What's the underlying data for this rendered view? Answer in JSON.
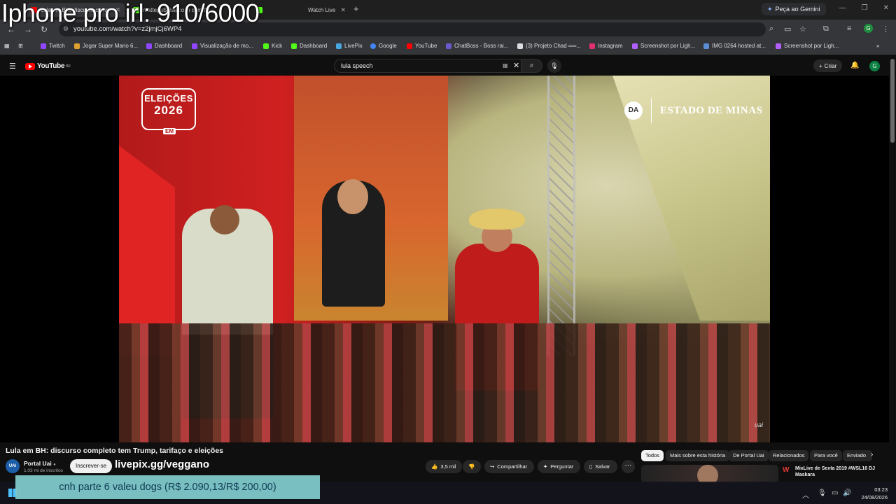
{
  "browser": {
    "tabs": [
      {
        "title": "Lula em BH: discurso comp",
        "active": true,
        "color": "#ff0000"
      },
      {
        "title": "mattepaSdisiaco in com.fhi",
        "active": false,
        "color": "#53fc18"
      },
      {
        "title": "Watch Live",
        "active": false,
        "color": "#53fc18"
      }
    ],
    "gemini_label": "Peça ao Gemini",
    "url": "youtube.com/watch?v=z2jmjCj6WP4",
    "profile_letter": "G"
  },
  "bookmarks": [
    {
      "label": "Twitch",
      "color": "#9146ff"
    },
    {
      "label": "Jogar Super Mario 6...",
      "color": "#e0a030"
    },
    {
      "label": "Dashboard",
      "color": "#9146ff"
    },
    {
      "label": "Visualização de mo...",
      "color": "#9146ff"
    },
    {
      "label": "Kick",
      "color": "#53fc18"
    },
    {
      "label": "Dashboard",
      "color": "#53fc18"
    },
    {
      "label": "LivePix",
      "color": "#4aa8e0"
    },
    {
      "label": "Google",
      "color": "#4285f4"
    },
    {
      "label": "YouTube",
      "color": "#ff0000"
    },
    {
      "label": "ChatBoss - Boss rai...",
      "color": "#6a5acd"
    },
    {
      "label": "(3) Projeto Chad ══...",
      "color": "#dddddd"
    },
    {
      "label": "Instagram",
      "color": "#e1306c"
    },
    {
      "label": "Screenshot por Ligh...",
      "color": "#b15fff"
    },
    {
      "label": "IMG 0264 hosted at...",
      "color": "#5a8fd6"
    },
    {
      "label": "Screenshot por Ligh...",
      "color": "#b15fff"
    }
  ],
  "youtube": {
    "logo_text": "YouTube",
    "logo_region": "BR",
    "search_value": "lula speech",
    "create_label": "Criar",
    "avatar_letter": "G"
  },
  "video": {
    "badge_line1": "ELEIÇÕES",
    "badge_line2": "2026",
    "badge_line3": "EM",
    "publisher_mark": "DA",
    "publisher_name": "ESTADO DE MINAS",
    "watermark": "uai",
    "title": "Lula em BH: discurso completo tem Trump, tarifaço e eleições"
  },
  "channel": {
    "name": "Portal Uai",
    "avatar_text": "UAI",
    "subscribers": "1,03 mi de inscritos",
    "subscribe_label": "Inscrever-se"
  },
  "actions": {
    "likes": "3,5 mil",
    "share": "Compartilhar",
    "ask": "Perguntar",
    "save": "Salvar"
  },
  "chips": [
    "Todos",
    "Mais sobre esta história",
    "De Portal Uai",
    "Relacionados",
    "Para você",
    "Enviado"
  ],
  "recommendation": {
    "title": "MixLive de Sexta 2019 #WSL16 DJ Maskara"
  },
  "overlays": {
    "counter": "Iphone pro irl: 910/6000",
    "livepix": "livepix.gg/veggano",
    "donation": "cnh parte 6 valeu dogs (R$ 2.090,13/R$ 200,00)"
  },
  "taskbar": {
    "time": "03:23",
    "date": "24/08/2026"
  }
}
